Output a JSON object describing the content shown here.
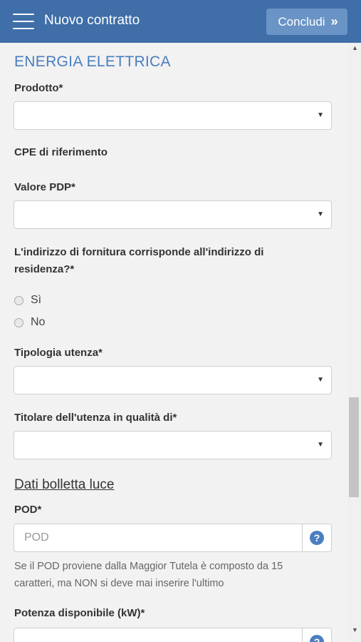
{
  "header": {
    "title": "Nuovo contratto",
    "conclude_label": "Concludi",
    "conclude_icon": "»",
    "menu_icon": "hamburger-icon"
  },
  "form": {
    "section_title": "ENERGIA ELETTRICA",
    "prodotto_label": "Prodotto*",
    "prodotto_value": "",
    "cpe_label": "CPE di riferimento",
    "valore_pdp_label": "Valore PDP*",
    "valore_pdp_value": "",
    "indirizzo_label_line1": "L'indirizzo di fornitura corrisponde all'indirizzo di",
    "indirizzo_label_line2": "residenza?*",
    "radio_si": "Sì",
    "radio_no": "No",
    "tipologia_label": "Tipologia utenza*",
    "tipologia_value": "",
    "titolare_label": "Titolare dell'utenza in qualità di*",
    "titolare_value": "",
    "bolletta_title": "Dati bolletta luce",
    "pod_label": "POD*",
    "pod_placeholder": "POD",
    "pod_help_line1": "Se il POD proviene dalla Maggior Tutela è composto da 15",
    "pod_help_line2": "caratteri, ma NON si deve mai inserire l'ultimo",
    "potenza_label": "Potenza disponibile (kW)*"
  },
  "icons": {
    "caret": "▼",
    "help": "?",
    "scroll_up": "▲",
    "scroll_down": "▼"
  },
  "colors": {
    "header_bg": "#3f6ea8",
    "button_bg": "#6a93c6",
    "section_title": "#4a7ec0",
    "help_icon": "#4a7ec0"
  }
}
